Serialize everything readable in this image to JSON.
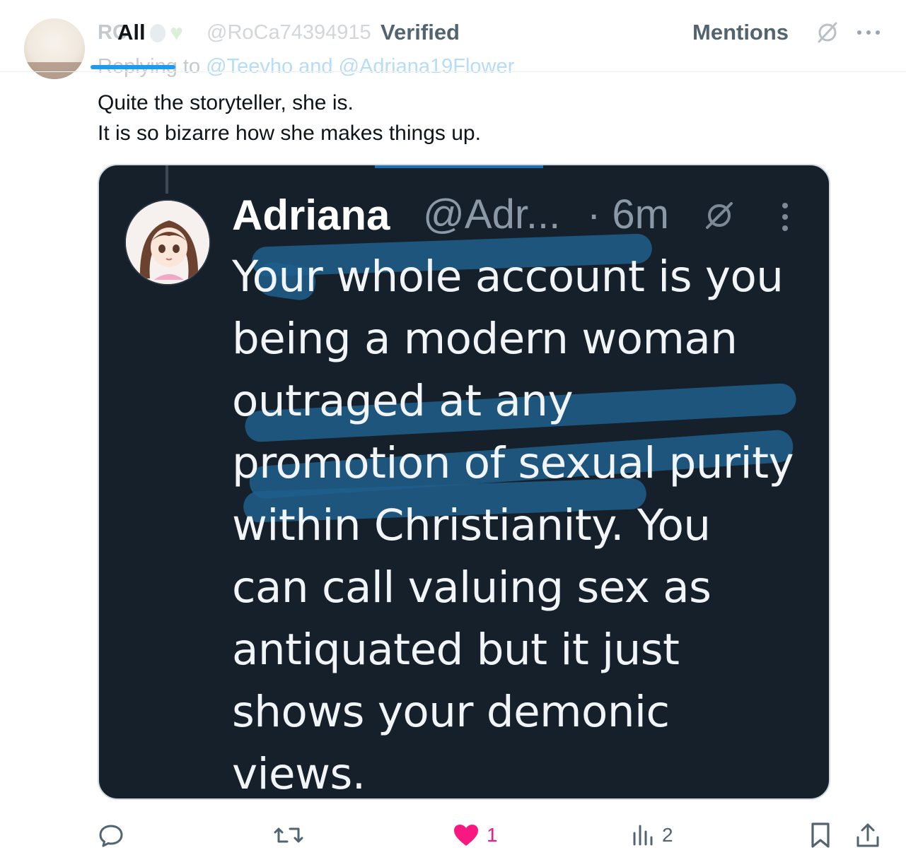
{
  "tabs": {
    "all": "All",
    "verified": "Verified",
    "mentions": "Mentions"
  },
  "background_tweet": {
    "name_fragment": "RC",
    "handle_fragment": "@RoCa74394915",
    "replying_prefix": "Replying to",
    "replying_targets": "@Teevho and @Adriana19Flower"
  },
  "tweet": {
    "lines": [
      "Quite the storyteller, she is.",
      "It is so bizarre how she makes things up."
    ]
  },
  "embedded": {
    "name": "Adriana",
    "handle": "@Adr...",
    "time": "· 6m",
    "text_lines": [
      "Your whole account is you",
      "being a modern woman",
      "outraged at any",
      "promotion of sexual purity",
      "within Christianity. You",
      "can call valuing sex as",
      "antiquated but it just",
      "shows your demonic",
      "views."
    ]
  },
  "actions": {
    "likes": "1",
    "views": "2"
  },
  "icons": {
    "reply": "reply-icon",
    "retweet": "retweet-icon",
    "like": "heart-icon",
    "views": "views-icon",
    "bookmark": "bookmark-icon",
    "share": "share-icon",
    "slash": "slash-icon",
    "more": "more-icon"
  },
  "colors": {
    "accent": "#1d9bf0",
    "like": "#f91880",
    "media_bg": "#16202b",
    "highlight": "#1e5f8c"
  }
}
